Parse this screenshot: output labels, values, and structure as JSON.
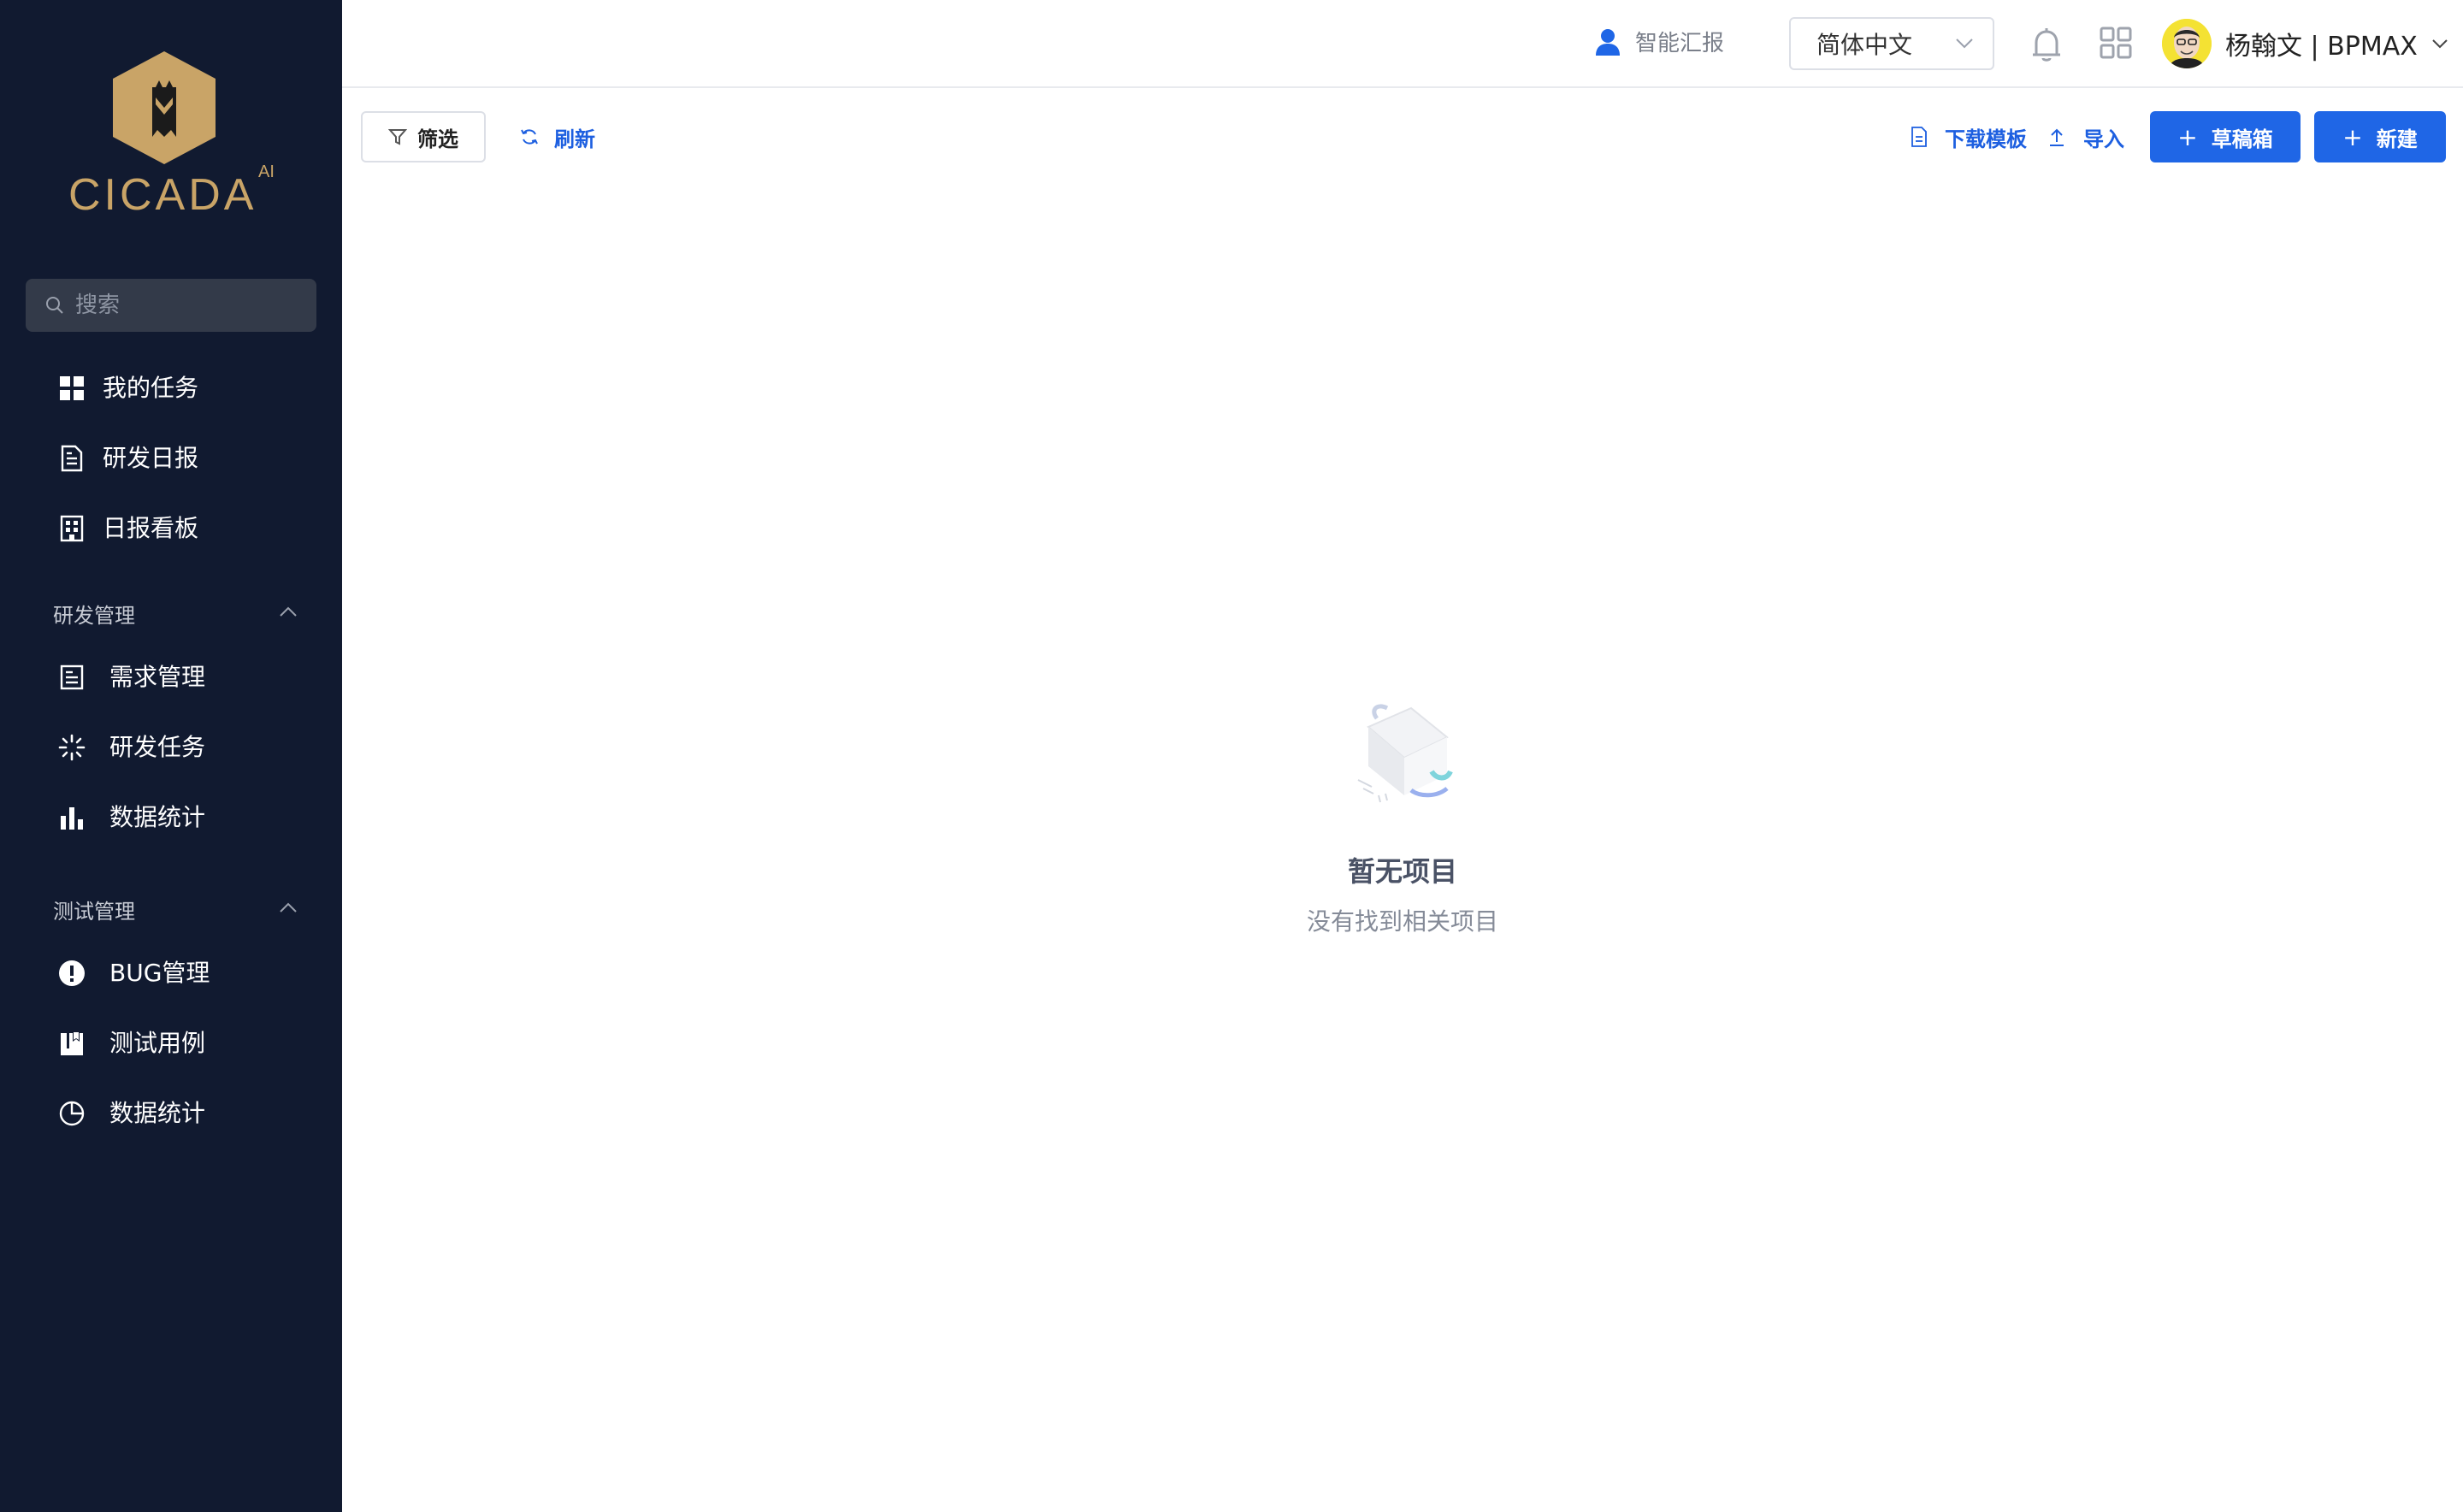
{
  "brand": {
    "wordmark": "CICADA",
    "superscript": "AI",
    "logo_color": "#c9a467"
  },
  "sidebar": {
    "search_placeholder": "搜索",
    "items": [
      {
        "label": "我的任务",
        "icon": "grid-icon"
      },
      {
        "label": "研发日报",
        "icon": "document-icon"
      },
      {
        "label": "日报看板",
        "icon": "building-icon"
      }
    ],
    "sections": [
      {
        "title": "研发管理",
        "items": [
          {
            "label": "需求管理",
            "icon": "list-document-icon"
          },
          {
            "label": "研发任务",
            "icon": "loading-spinner-icon"
          },
          {
            "label": "数据统计",
            "icon": "bar-chart-icon"
          }
        ]
      },
      {
        "title": "测试管理",
        "items": [
          {
            "label": "BUG管理",
            "icon": "alert-circle-icon"
          },
          {
            "label": "测试用例",
            "icon": "book-icon"
          },
          {
            "label": "数据统计",
            "icon": "pie-chart-icon"
          }
        ]
      }
    ]
  },
  "header": {
    "ai_report": "智能汇报",
    "language": "简体中文",
    "user_name": "杨翰文 | BPMAX"
  },
  "toolbar": {
    "filter": "筛选",
    "refresh": "刷新",
    "download_template": "下载模板",
    "import": "导入",
    "drafts": "草稿箱",
    "new": "新建"
  },
  "empty_state": {
    "title": "暂无项目",
    "description": "没有找到相关项目"
  },
  "colors": {
    "sidebar_bg": "#111a30",
    "primary": "#1f66e6",
    "link": "#1d5fe0"
  }
}
